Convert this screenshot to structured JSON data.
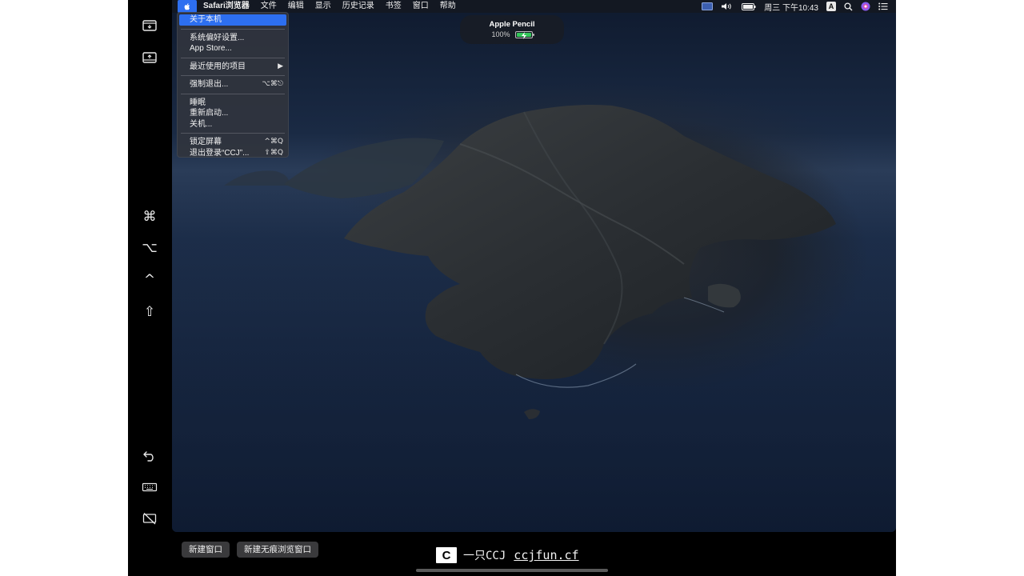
{
  "menubar": {
    "app_name": "Safari浏览器",
    "items": [
      "文件",
      "编辑",
      "显示",
      "历史记录",
      "书签",
      "窗口",
      "帮助"
    ],
    "clock": "周三 下午10:43",
    "input_method": "A"
  },
  "apple_menu": {
    "groups": [
      [
        {
          "label": "关于本机",
          "shortcut": "",
          "highlighted": true
        }
      ],
      [
        {
          "label": "系统偏好设置...",
          "shortcut": ""
        },
        {
          "label": "App Store...",
          "shortcut": ""
        }
      ],
      [
        {
          "label": "最近使用的项目",
          "shortcut": "▶"
        }
      ],
      [
        {
          "label": "强制退出...",
          "shortcut": "⌥⌘⎋"
        }
      ],
      [
        {
          "label": "睡眠",
          "shortcut": ""
        },
        {
          "label": "重新启动...",
          "shortcut": ""
        },
        {
          "label": "关机...",
          "shortcut": ""
        }
      ],
      [
        {
          "label": "锁定屏幕",
          "shortcut": "^⌘Q"
        },
        {
          "label": "退出登录“CCJ”...",
          "shortcut": "⇧⌘Q"
        }
      ]
    ]
  },
  "pencil_hud": {
    "title": "Apple Pencil",
    "battery": "100%"
  },
  "sidebar": {
    "modifier_keys": [
      "⌘",
      "⌥",
      "^",
      "⇧"
    ]
  },
  "touchbar": {
    "new_window": "新建窗口",
    "new_private_window": "新建无痕浏览窗口"
  },
  "watermark": {
    "logo": "C",
    "name": "一只CCJ",
    "url": "ccjfun.cf"
  },
  "colors": {
    "accent": "#2d6ff0",
    "battery": "#34c759"
  }
}
